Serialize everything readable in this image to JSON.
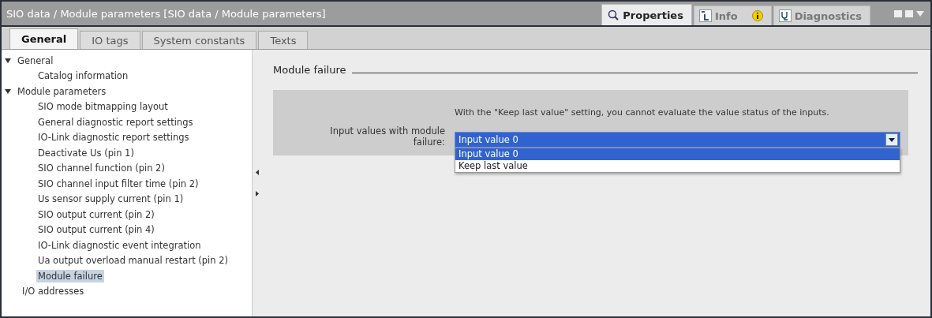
{
  "window": {
    "title": "SIO data / Module parameters [SIO data / Module parameters]"
  },
  "inspector_tabs": [
    {
      "label": "Properties",
      "kind": "properties",
      "selected": true
    },
    {
      "label": "Info",
      "kind": "info",
      "selected": false
    },
    {
      "label": "Diagnostics",
      "kind": "diagnostics",
      "selected": false
    }
  ],
  "tabs": [
    {
      "label": "General",
      "selected": true
    },
    {
      "label": "IO tags",
      "selected": false
    },
    {
      "label": "System constants",
      "selected": false
    },
    {
      "label": "Texts",
      "selected": false
    }
  ],
  "tree": [
    {
      "label": "General",
      "expanded": true,
      "selected": false,
      "children": [
        {
          "label": "Catalog information",
          "selected": false
        }
      ]
    },
    {
      "label": "Module parameters",
      "expanded": true,
      "selected": false,
      "children": [
        {
          "label": "SIO mode bitmapping layout",
          "selected": false
        },
        {
          "label": "General diagnostic report settings",
          "selected": false
        },
        {
          "label": "IO-Link diagnostic report settings",
          "selected": false
        },
        {
          "label": "Deactivate Us (pin 1)",
          "selected": false
        },
        {
          "label": "SIO channel function (pin 2)",
          "selected": false
        },
        {
          "label": "SIO channel input filter time (pin 2)",
          "selected": false
        },
        {
          "label": "Us sensor supply current (pin 1)",
          "selected": false
        },
        {
          "label": "SIO output current (pin 2)",
          "selected": false
        },
        {
          "label": "SIO output current (pin 4)",
          "selected": false
        },
        {
          "label": "IO-Link diagnostic event integration",
          "selected": false
        },
        {
          "label": "Ua output overload manual restart (pin 2)",
          "selected": false
        },
        {
          "label": "Module failure",
          "selected": true
        }
      ]
    },
    {
      "label": "I/O addresses",
      "selected": false
    }
  ],
  "section": {
    "title": "Module failure",
    "note": "With the \"Keep last value\" setting, you cannot evaluate the value status of the inputs.",
    "field_label": "Input values with module failure:",
    "value": "Input value 0",
    "expanded": true,
    "options": [
      {
        "label": "Input value 0",
        "selected": true
      },
      {
        "label": "Keep last value",
        "selected": false
      }
    ]
  }
}
